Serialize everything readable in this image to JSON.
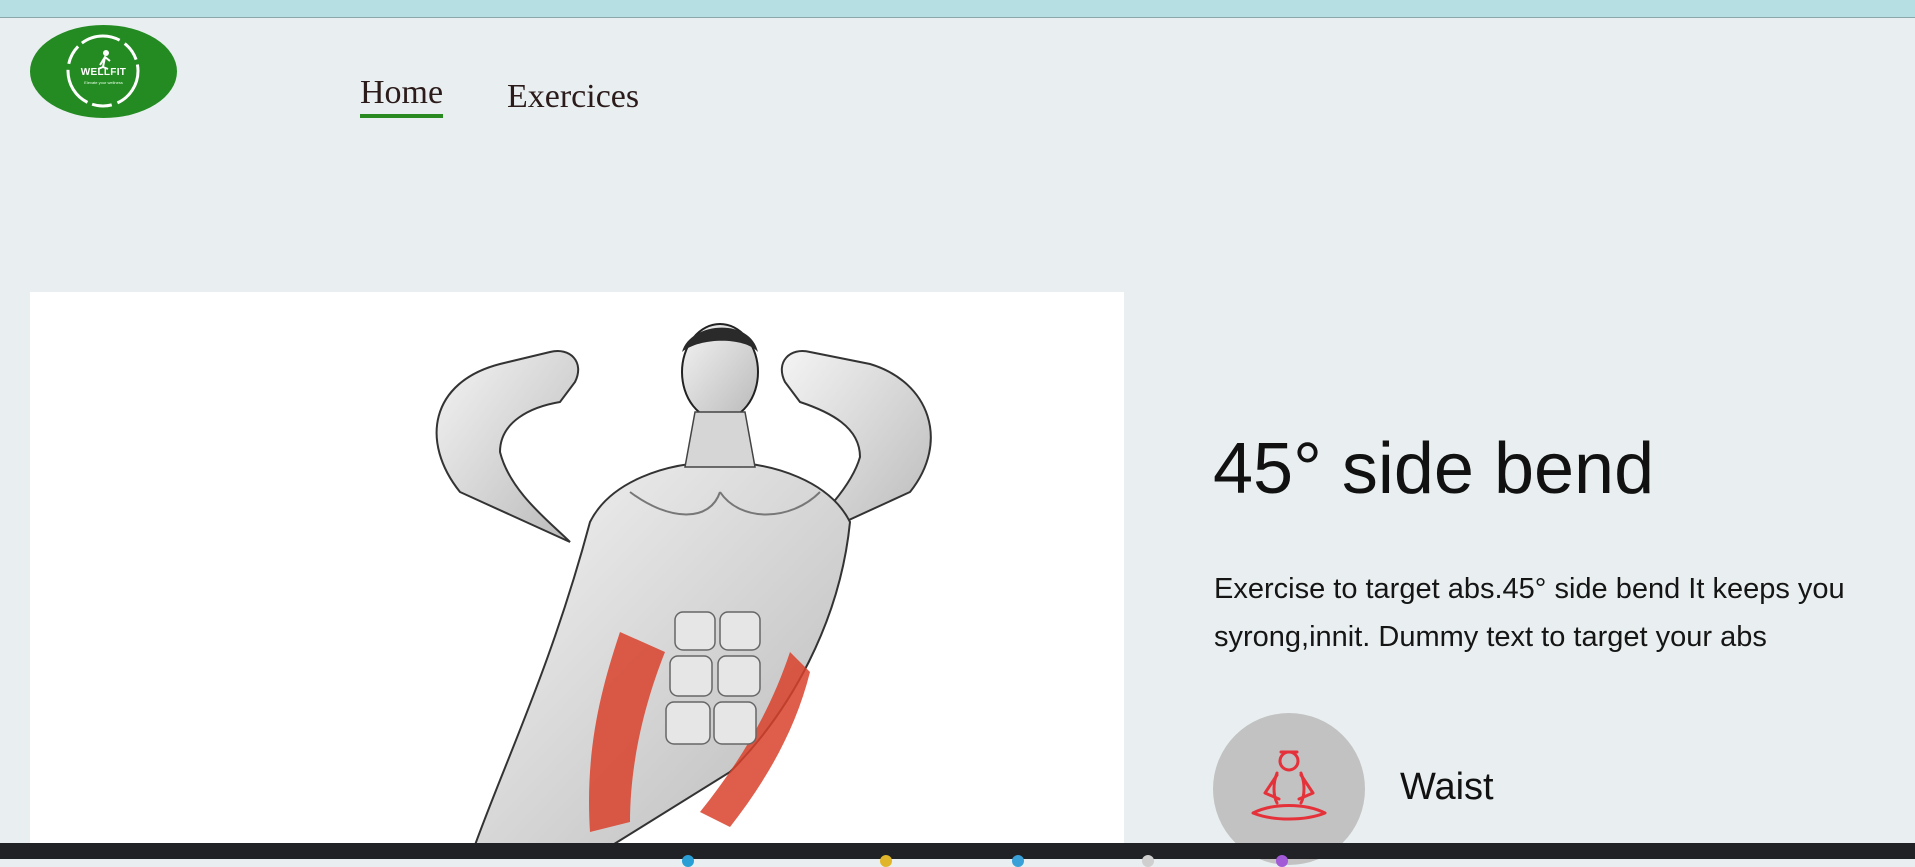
{
  "logo": {
    "name": "WELLFIT",
    "tagline": "Elevate your wellness"
  },
  "nav": {
    "home": "Home",
    "exercises": "Exercices"
  },
  "exercise": {
    "title": "45° side bend",
    "description": "Exercise to target abs.45° side bend It keeps you syrong,innit. Dummy text to target your abs",
    "target_muscle": "Waist"
  },
  "colors": {
    "brand_green": "#238b22",
    "muscle_highlight": "#d8412b",
    "icon_red": "#e5323a"
  },
  "icons": {
    "body_part": "meditation-pose-icon",
    "logo_mark": "runner-icon"
  }
}
